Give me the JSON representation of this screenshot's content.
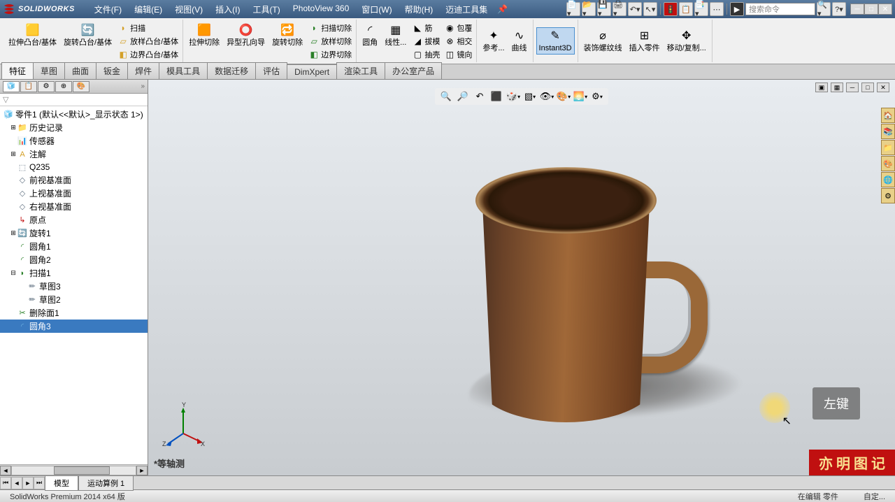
{
  "app": {
    "name": "SOLIDWORKS"
  },
  "menu": {
    "file": "文件(F)",
    "edit": "编辑(E)",
    "view": "视图(V)",
    "insert": "插入(I)",
    "tools": "工具(T)",
    "photoview": "PhotoView 360",
    "window": "窗口(W)",
    "help": "帮助(H)",
    "midi": "迈迪工具集"
  },
  "search_placeholder": "搜索命令",
  "ribbon": {
    "extrude": "拉伸凸台/基体",
    "revolve": "旋转凸台/基体",
    "sweep": "扫描",
    "loft": "放样凸台/基体",
    "boundary": "边界凸台/基体",
    "cut_extrude": "拉伸切除",
    "hole": "异型孔向导",
    "cut_revolve": "旋转切除",
    "cut_sweep": "扫描切除",
    "cut_loft": "放样切除",
    "cut_boundary": "边界切除",
    "fillet": "圆角",
    "linear": "线性...",
    "rib": "筋",
    "draft": "拔模",
    "shell": "抽壳",
    "wrap": "包覆",
    "intersect": "相交",
    "mirror": "镜向",
    "refgeom": "参考...",
    "curves": "曲线",
    "instant3d": "Instant3D",
    "decor": "装饰螺纹线",
    "insertpart": "插入零件",
    "movecopy": "移动/复制..."
  },
  "tabs": {
    "features": "特征",
    "sketch": "草图",
    "surfaces": "曲面",
    "sheetmetal": "钣金",
    "weldments": "焊件",
    "moldtools": "模具工具",
    "datamigration": "数据迁移",
    "evaluate": "评估",
    "dimxpert": "DimXpert",
    "render": "渲染工具",
    "office": "办公室产品"
  },
  "tree": {
    "filter": "▽",
    "part_name": "零件1 (默认<<默认>_显示状态 1>)",
    "history": "历史记录",
    "sensors": "传感器",
    "annotations": "注解",
    "material": "Q235",
    "front": "前视基准面",
    "top": "上视基准面",
    "right": "右视基准面",
    "origin": "原点",
    "revolve1": "旋转1",
    "fillet1": "圆角1",
    "fillet2": "圆角2",
    "sweep1": "扫描1",
    "sketch3": "草图3",
    "sketch2": "草图2",
    "deleteface1": "删除面1",
    "fillet3": "圆角3"
  },
  "viewport": {
    "view_label": "*等轴测"
  },
  "click_hint": "左键",
  "watermark": "亦 明 图 记",
  "bottom_tabs": {
    "model": "模型",
    "motion1": "运动算例 1"
  },
  "status": {
    "version": "SolidWorks Premium 2014 x64 版",
    "editing": "在编辑 零件",
    "custom": "自定..."
  }
}
